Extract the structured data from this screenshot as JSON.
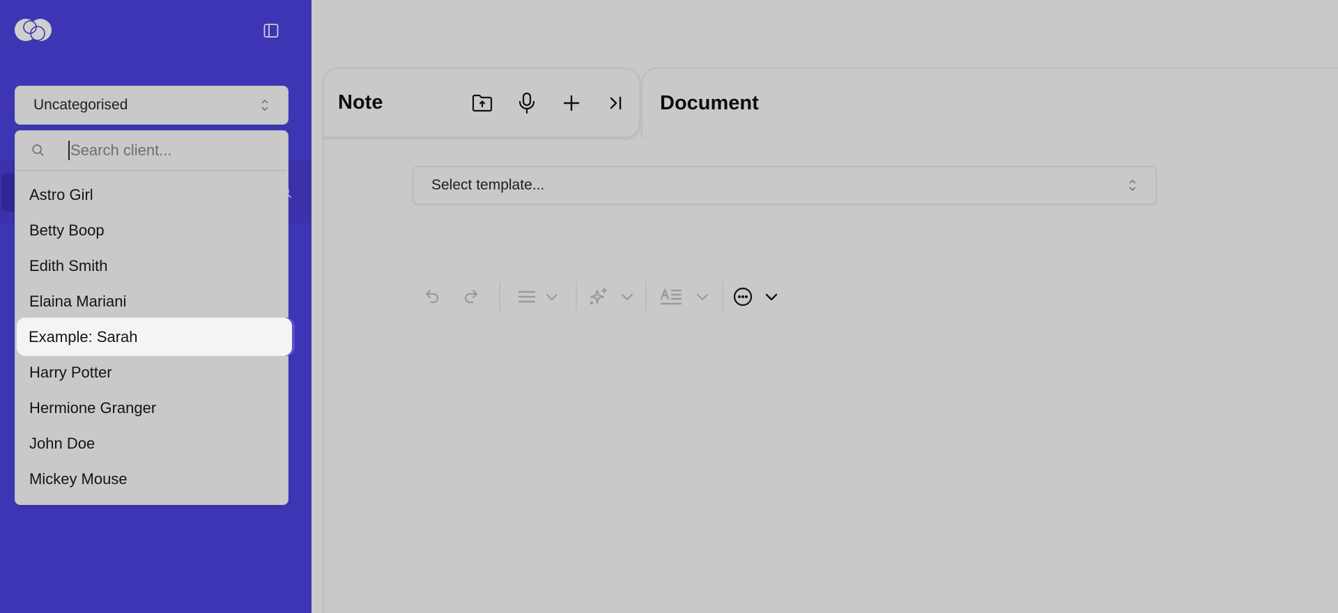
{
  "sidebar": {
    "logo_icon": "overlapping-circles-logo",
    "collapse_icon": "sidebar-panel-icon",
    "category_select": {
      "value": "Uncategorised",
      "icon": "chevron-up-down-icon"
    },
    "client_popover": {
      "search": {
        "icon": "search-icon",
        "placeholder": "Search client...",
        "value": ""
      },
      "clients": [
        {
          "label": "Astro Girl"
        },
        {
          "label": "Betty Boop"
        },
        {
          "label": "Edith Smith"
        },
        {
          "label": "Elaina Mariani"
        },
        {
          "label": "Example: Sarah",
          "highlighted": true
        },
        {
          "label": "Harry Potter"
        },
        {
          "label": "Hermione Granger"
        },
        {
          "label": "John Doe"
        },
        {
          "label": "Mickey Mouse"
        }
      ]
    }
  },
  "note_panel": {
    "title": "Note",
    "actions": [
      {
        "name": "upload-folder",
        "icon": "folder-upload-icon"
      },
      {
        "name": "record",
        "icon": "microphone-icon"
      },
      {
        "name": "add",
        "icon": "plus-icon"
      },
      {
        "name": "collapse",
        "icon": "arrow-right-to-line-icon"
      }
    ]
  },
  "document_panel": {
    "title": "Document",
    "template_select": {
      "placeholder": "Select template...",
      "icon": "chevron-up-down-icon"
    },
    "toolbar": {
      "items": [
        {
          "name": "undo",
          "icon": "undo-icon",
          "enabled": false
        },
        {
          "name": "redo",
          "icon": "redo-icon",
          "enabled": false
        },
        {
          "name": "align",
          "icon": "align-lines-icon",
          "enabled": false
        },
        {
          "name": "ai-actions",
          "icon": "sparkles-icon",
          "enabled": false
        },
        {
          "name": "text-style",
          "icon": "text-format-icon",
          "enabled": false
        },
        {
          "name": "more",
          "icon": "ellipsis-circle-icon",
          "enabled": true
        }
      ]
    }
  },
  "colors": {
    "sidebar_bg": "#3d35b4",
    "overlay_bg": "#c9c9c9",
    "highlight_bg": "#f4f4f4",
    "accent": "#5850d8"
  }
}
